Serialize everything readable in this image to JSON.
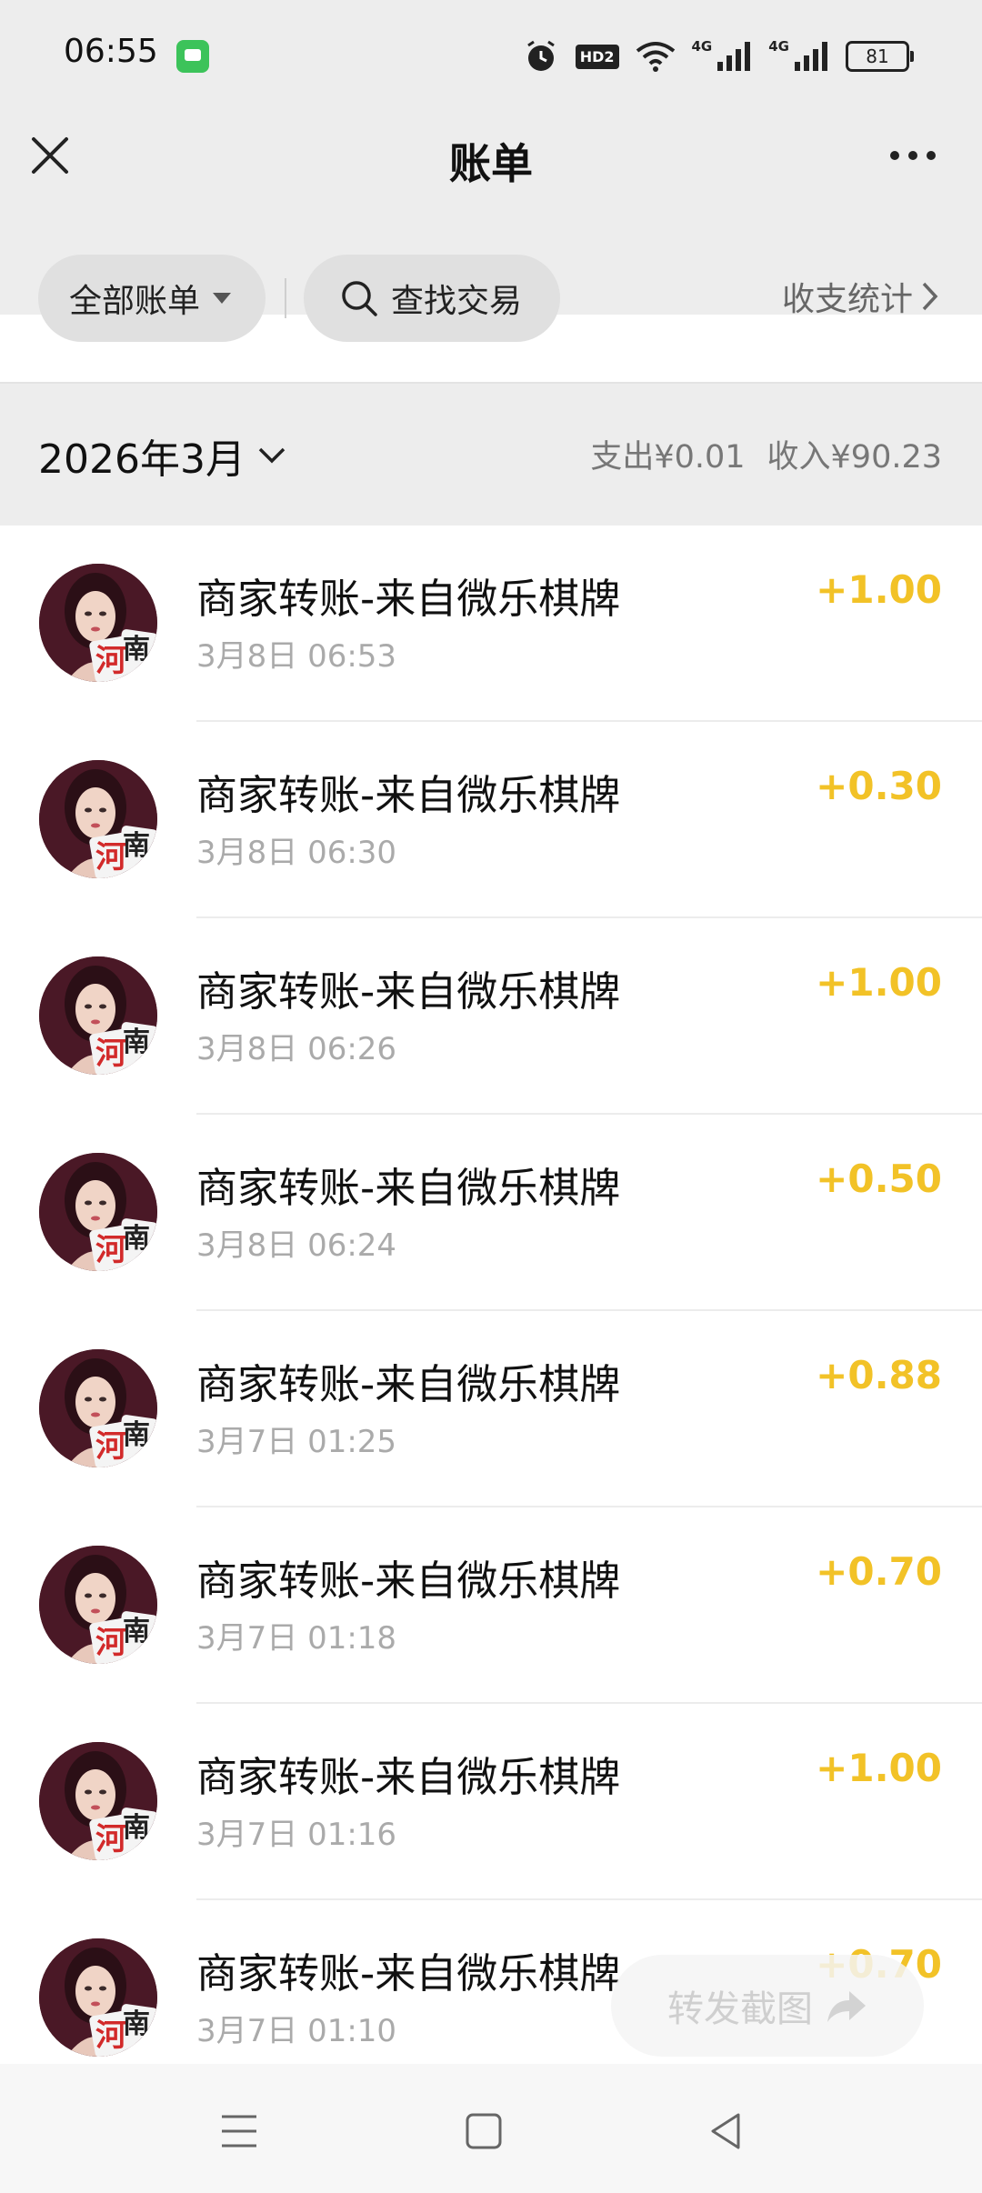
{
  "status_bar": {
    "time": "06:55",
    "hd_label": "HD2",
    "signal_label_1": "4G",
    "signal_label_2": "4G",
    "battery": "81",
    "icons": [
      "message-app-icon",
      "alarm-icon",
      "hd-voice-icon",
      "wifi-icon",
      "signal-icon",
      "signal-icon",
      "battery-icon"
    ]
  },
  "nav": {
    "title": "账单",
    "close_icon": "close-icon",
    "more_icon": "more-icon"
  },
  "filters": {
    "all_bills_label": "全部账单",
    "search_label": "查找交易",
    "stats_label": "收支统计"
  },
  "month": {
    "label": "2026年3月",
    "expense_summary": "支出¥0.01",
    "income_summary": "收入¥90.23"
  },
  "transactions": [
    {
      "title": "商家转账-来自微乐棋牌",
      "time": "3月8日 06:53",
      "amount": "+1.00"
    },
    {
      "title": "商家转账-来自微乐棋牌",
      "time": "3月8日 06:30",
      "amount": "+0.30"
    },
    {
      "title": "商家转账-来自微乐棋牌",
      "time": "3月8日 06:26",
      "amount": "+1.00"
    },
    {
      "title": "商家转账-来自微乐棋牌",
      "time": "3月8日 06:24",
      "amount": "+0.50"
    },
    {
      "title": "商家转账-来自微乐棋牌",
      "time": "3月7日 01:25",
      "amount": "+0.88"
    },
    {
      "title": "商家转账-来自微乐棋牌",
      "time": "3月7日 01:18",
      "amount": "+0.70"
    },
    {
      "title": "商家转账-来自微乐棋牌",
      "time": "3月7日 01:16",
      "amount": "+1.00"
    },
    {
      "title": "商家转账-来自微乐棋牌",
      "time": "3月7日 01:10",
      "amount": "+0.70"
    }
  ],
  "avatar_text": {
    "char1": "河",
    "char2": "南"
  },
  "share": {
    "label": "转发截图"
  },
  "colors": {
    "accent_income": "#f2c227",
    "background": "#ededed"
  }
}
